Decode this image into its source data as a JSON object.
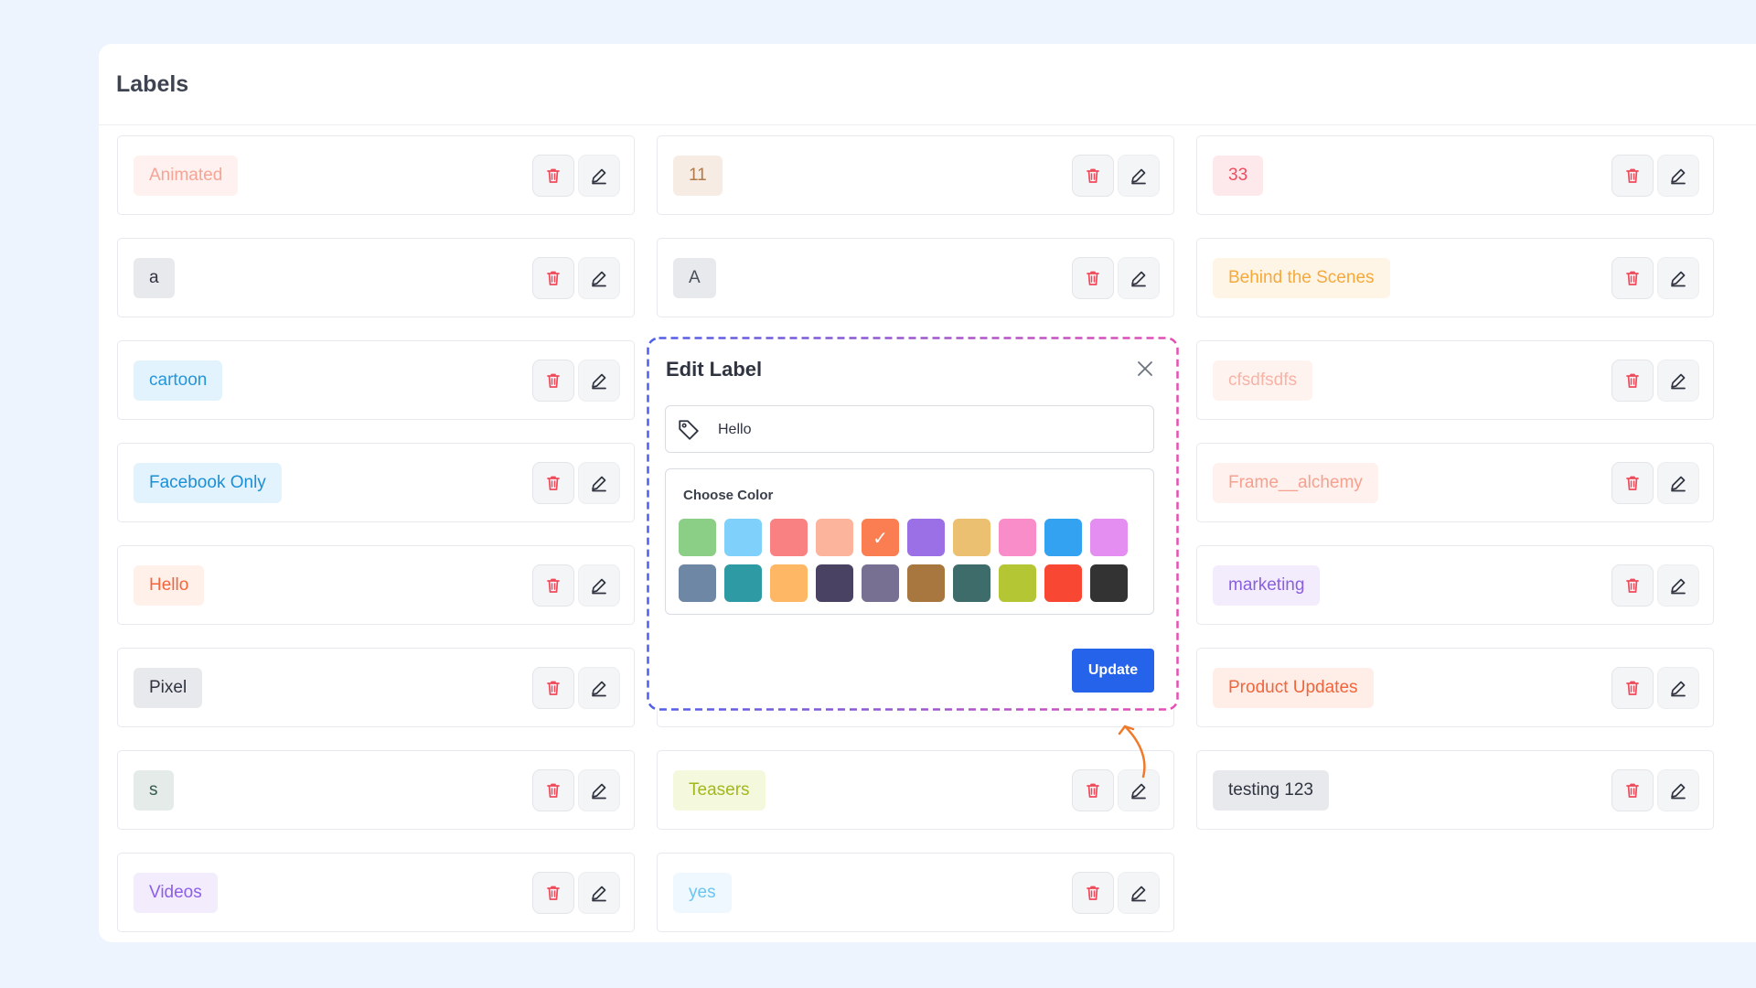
{
  "page": {
    "title": "Labels"
  },
  "actions": {
    "delete_icon": "trash-icon",
    "edit_icon": "pencil-icon"
  },
  "columns": [
    [
      {
        "label": "Animated",
        "text": "#f5a596",
        "bg": "#fff1ef"
      },
      {
        "label": "a",
        "text": "#2f3440",
        "bg": "#e8e9ec"
      },
      {
        "label": "cartoon",
        "text": "#2596d8",
        "bg": "#e3f3fd"
      },
      {
        "label": "Facebook Only",
        "text": "#1a8fd6",
        "bg": "#e3f3fd"
      },
      {
        "label": "Hello",
        "text": "#f5653b",
        "bg": "#fff0ea"
      },
      {
        "label": "Pixel",
        "text": "#2f3440",
        "bg": "#e8e9ec"
      },
      {
        "label": "s",
        "text": "#355a50",
        "bg": "#e5ebe9"
      },
      {
        "label": "Videos",
        "text": "#8d5ee8",
        "bg": "#f2ecfd"
      }
    ],
    [
      {
        "label": "11",
        "text": "#b27a4a",
        "bg": "#f6ece3"
      },
      {
        "label": "A",
        "text": "#4a4f5c",
        "bg": "#e8e9ec"
      },
      {
        "label": "",
        "text": "#2f3440",
        "bg": "#ffffff"
      },
      {
        "label": "",
        "text": "#2f3440",
        "bg": "#ffffff"
      },
      {
        "label": "",
        "text": "#2f3440",
        "bg": "#ffffff"
      },
      {
        "label": "",
        "text": "#2f3440",
        "bg": "#ffffff"
      },
      {
        "label": "Teasers",
        "text": "#a3b81a",
        "bg": "#f4f8dc"
      },
      {
        "label": "yes",
        "text": "#6cc4f0",
        "bg": "#eef8fe"
      }
    ],
    [
      {
        "label": "33",
        "text": "#f04c5e",
        "bg": "#fde9ec"
      },
      {
        "label": "Behind the Scenes",
        "text": "#f5a93b",
        "bg": "#fff5e6"
      },
      {
        "label": "cfsdfsdfs",
        "text": "#f7b3a6",
        "bg": "#fff3f0"
      },
      {
        "label": "Frame__alchemy",
        "text": "#f6a08f",
        "bg": "#fff1ee"
      },
      {
        "label": "marketing",
        "text": "#8a5fe0",
        "bg": "#f2ecfd"
      },
      {
        "label": "Product Updates",
        "text": "#f0653b",
        "bg": "#ffeee8"
      },
      {
        "label": "testing 123",
        "text": "#2f3440",
        "bg": "#e8e9ec"
      }
    ]
  ],
  "modal": {
    "title": "Edit Label",
    "input_value": "Hello",
    "color_section_title": "Choose Color",
    "swatches": [
      [
        "#8bce86",
        "#7fd0fb",
        "#fa8182",
        "#fcb49c",
        "#fb7d52",
        "#9b6fe6",
        "#ebc070",
        "#f88dc9",
        "#33a3f1",
        "#e38ef0"
      ],
      [
        "#6d87a5",
        "#2e9aa3",
        "#fdb765",
        "#4a4263",
        "#787092",
        "#a7773f",
        "#3d6c6a",
        "#b5c634",
        "#f84732",
        "#333333"
      ]
    ],
    "selected_swatch": "#fb7d52",
    "update_label": "Update"
  }
}
